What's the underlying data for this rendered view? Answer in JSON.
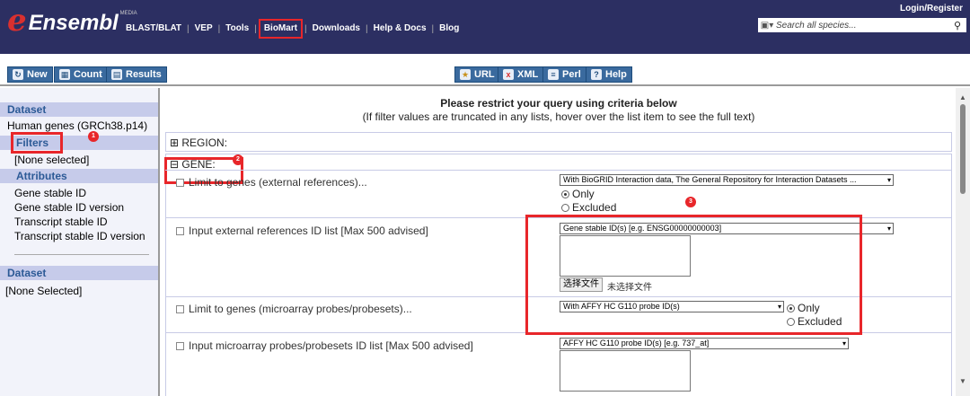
{
  "header": {
    "logo_e": "e",
    "logo_text": "Ensembl",
    "logo_sup": "MEDIA",
    "nav": [
      "BLAST/BLAT",
      "VEP",
      "Tools",
      "BioMart",
      "Downloads",
      "Help & Docs",
      "Blog"
    ],
    "active_nav": "BioMart",
    "login": "Login/Register",
    "search_placeholder": "Search all species..."
  },
  "toolbar": {
    "new": "New",
    "count": "Count",
    "results": "Results",
    "url": "URL",
    "xml": "XML",
    "perl": "Perl",
    "help": "Help"
  },
  "sidebar": {
    "dataset_head": "Dataset",
    "dataset_value": "Human genes (GRCh38.p14)",
    "filters_head": "Filters",
    "filters_value": "[None selected]",
    "attributes_head": "Attributes",
    "attributes": [
      "Gene stable ID",
      "Gene stable ID version",
      "Transcript stable ID",
      "Transcript stable ID version"
    ],
    "dataset2_head": "Dataset",
    "dataset2_value": "[None Selected]"
  },
  "badges": [
    "1",
    "2",
    "3"
  ],
  "main": {
    "title": "Please restrict your query using criteria below",
    "subtitle": "(If filter values are truncated in any lists, hover over the list item to see the full text)",
    "region_head": "⊞ REGION:",
    "gene_head": "⊟ GENE:",
    "filters": {
      "limit_external": "Limit to genes (external references)...",
      "limit_external_select": "With BioGRID Interaction data, The General Repository for Interaction Datasets ...",
      "only": "Only",
      "excluded": "Excluded",
      "input_external": "Input external references ID list [Max 500 advised]",
      "input_external_select": "Gene stable ID(s) [e.g. ENSG00000000003]",
      "file_button": "选择文件",
      "file_none": "未选择文件",
      "limit_microarray": "Limit to genes (microarray probes/probesets)...",
      "limit_microarray_select": "With AFFY HC G110 probe ID(s)",
      "input_microarray": "Input microarray probes/probesets ID list [Max 500 advised]",
      "input_microarray_select": "AFFY HC G110 probe ID(s) [e.g. 737_at]"
    }
  },
  "colors": {
    "header_bg": "#2c2f62",
    "accent_red": "#e8262a",
    "button_blue": "#3a6a9e",
    "sidebar_head": "#c6cbea"
  }
}
